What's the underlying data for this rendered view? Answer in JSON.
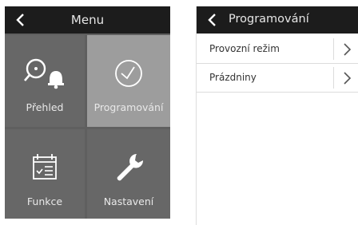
{
  "left_screen": {
    "title": "Menu",
    "tiles": [
      {
        "label": "Přehled",
        "icon": "overview-icon",
        "active": false
      },
      {
        "label": "Programování",
        "icon": "clock-icon",
        "active": true
      },
      {
        "label": "Funkce",
        "icon": "calendar-icon",
        "active": false
      },
      {
        "label": "Nastavení",
        "icon": "wrench-icon",
        "active": false
      }
    ]
  },
  "right_screen": {
    "title": "Programování",
    "items": [
      {
        "label": "Provozní režim"
      },
      {
        "label": "Prázdniny"
      }
    ]
  },
  "colors": {
    "header": "#1c1c1c",
    "tile": "#676767",
    "tile_active": "#9d9d9d",
    "divider": "#5f5f5f"
  }
}
